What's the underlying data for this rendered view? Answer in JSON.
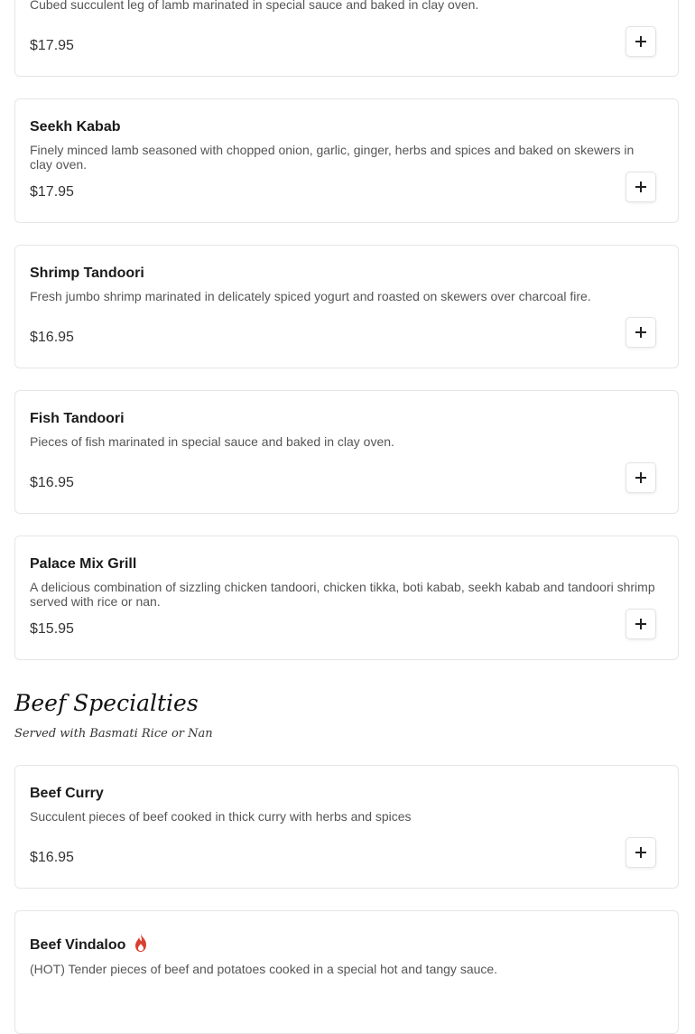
{
  "items": [
    {
      "name": "",
      "description": "Cubed succulent leg of lamb marinated in special sauce and baked in clay oven.",
      "price": "$17.95"
    },
    {
      "name": "Seekh Kabab",
      "description": "Finely minced lamb seasoned with chopped onion, garlic, ginger, herbs and spices and baked on skewers in clay oven.",
      "price": "$17.95"
    },
    {
      "name": "Shrimp Tandoori",
      "description": "Fresh jumbo shrimp marinated in delicately spiced yogurt and roasted on skewers over charcoal fire.",
      "price": "$16.95"
    },
    {
      "name": "Fish Tandoori",
      "description": "Pieces of fish marinated in special sauce and baked in clay oven.",
      "price": "$16.95"
    },
    {
      "name": "Palace Mix Grill",
      "description": "A delicious combination of sizzling chicken tandoori, chicken tikka, boti kabab, seekh kabab and tandoori shrimp served with rice or nan.",
      "price": "$15.95"
    }
  ],
  "section": {
    "title": "Beef Specialties",
    "subtitle": "Served with Basmati Rice or Nan"
  },
  "beef_items": [
    {
      "name": "Beef Curry",
      "description": "Succulent pieces of beef cooked in thick curry with herbs and spices",
      "price": "$16.95"
    },
    {
      "name": "Beef Vindaloo",
      "description": "(HOT) Tender pieces of beef and potatoes cooked in a special hot and tangy sauce.",
      "price": "",
      "icon": "flame-icon"
    }
  ],
  "colors": {
    "flame": "#d9402f",
    "border": "#e6e6e6"
  }
}
